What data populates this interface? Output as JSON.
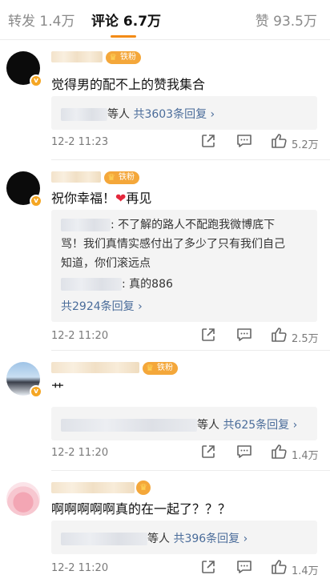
{
  "tabs": {
    "repost_label": "转发 1.4万",
    "comment_label": "评论 6.7万",
    "like_label": "赞 93.5万"
  },
  "colors": {
    "accent": "#f38b16",
    "link": "#4a6c9a",
    "fan_badge": "#f4a73a",
    "heart": "#e4283c"
  },
  "badge_text": "铁粉",
  "comments": [
    {
      "text": "觉得男的配不上的赞我集合",
      "reply_summary": {
        "people": "等人",
        "count": "共3603条回复 ›"
      },
      "time": "12-2 11:23",
      "likes": "5.2万"
    },
    {
      "text": "祝你幸福！",
      "heart": "❤",
      "text_tail": "再见",
      "replies": [
        {
          "line1": ": 不了解的路人不配跑我微博底下",
          "line2": "骂！我们真情实感付出了多少了只有我们自己",
          "line3": "知道，你们滚远点"
        },
        {
          "line1": ": 真的886"
        }
      ],
      "reply_count": "共2924条回复 ›",
      "time": "12-2 11:20",
      "likes": "2.5万"
    },
    {
      "text": "艹",
      "reply_summary": {
        "people": "等人",
        "count": "共625条回复 ›"
      },
      "time": "12-2 11:20",
      "likes": "1.4万"
    },
    {
      "text": "啊啊啊啊啊真的在一起了？？？",
      "reply_summary": {
        "people": "等人",
        "count": "共396条回复 ›"
      },
      "time": "12-2 11:20",
      "likes": "1.4万"
    }
  ]
}
